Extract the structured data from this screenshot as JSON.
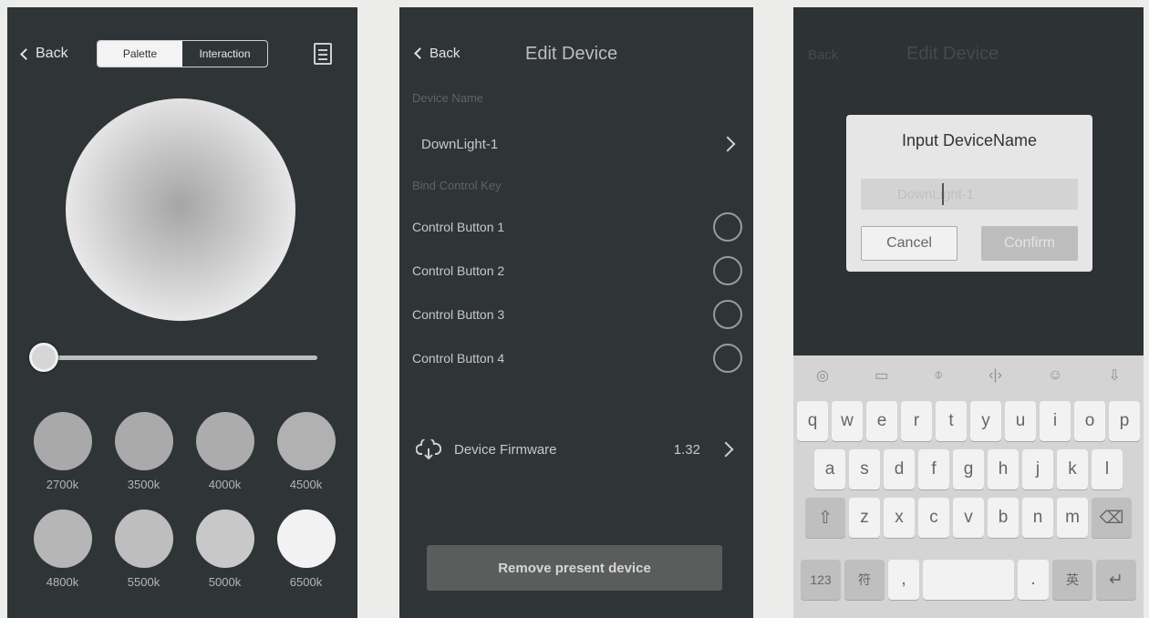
{
  "palette_screen": {
    "back_label": "Back",
    "tabs": [
      "Palette",
      "Interaction"
    ],
    "active_tab": "Palette",
    "slider_level": 0.0,
    "presets": [
      {
        "label": "2700k",
        "color": "#a9a9a9"
      },
      {
        "label": "3500k",
        "color": "#aaaaaa"
      },
      {
        "label": "4000k",
        "color": "#acacac"
      },
      {
        "label": "4500k",
        "color": "#b1b1b1"
      },
      {
        "label": "4800k",
        "color": "#b6b6b6"
      },
      {
        "label": "5500k",
        "color": "#bebebe"
      },
      {
        "label": "5000k",
        "color": "#c8c8c8"
      },
      {
        "label": "6500k",
        "color": "#f2f2f2"
      }
    ]
  },
  "edit_screen": {
    "back_label": "Back",
    "title": "Edit Device",
    "device_name_section": "Device Name",
    "device_name_value": "DownLight-1",
    "bind_section": "Bind Control Key",
    "control_buttons": [
      "Control Button 1",
      "Control Button 2",
      "Control Button 3",
      "Control Button 4"
    ],
    "firmware_label": "Device Firmware",
    "firmware_version": "1.32",
    "remove_button": "Remove present device"
  },
  "dialog_screen": {
    "ghost_back": "Back",
    "ghost_title": "Edit Device",
    "dialog_title": "Input DeviceName",
    "input_value": "DownLight-1",
    "cancel_label": "Cancel",
    "confirm_label": "Confirm",
    "keyboard": {
      "row1": [
        "q",
        "w",
        "e",
        "r",
        "t",
        "y",
        "u",
        "i",
        "o",
        "p"
      ],
      "row2": [
        "a",
        "s",
        "d",
        "f",
        "g",
        "h",
        "j",
        "k",
        "l"
      ],
      "row3": [
        "z",
        "x",
        "c",
        "v",
        "b",
        "n",
        "m"
      ],
      "row4": [
        "123",
        "符",
        ",",
        "",
        ".",
        "英"
      ]
    }
  }
}
